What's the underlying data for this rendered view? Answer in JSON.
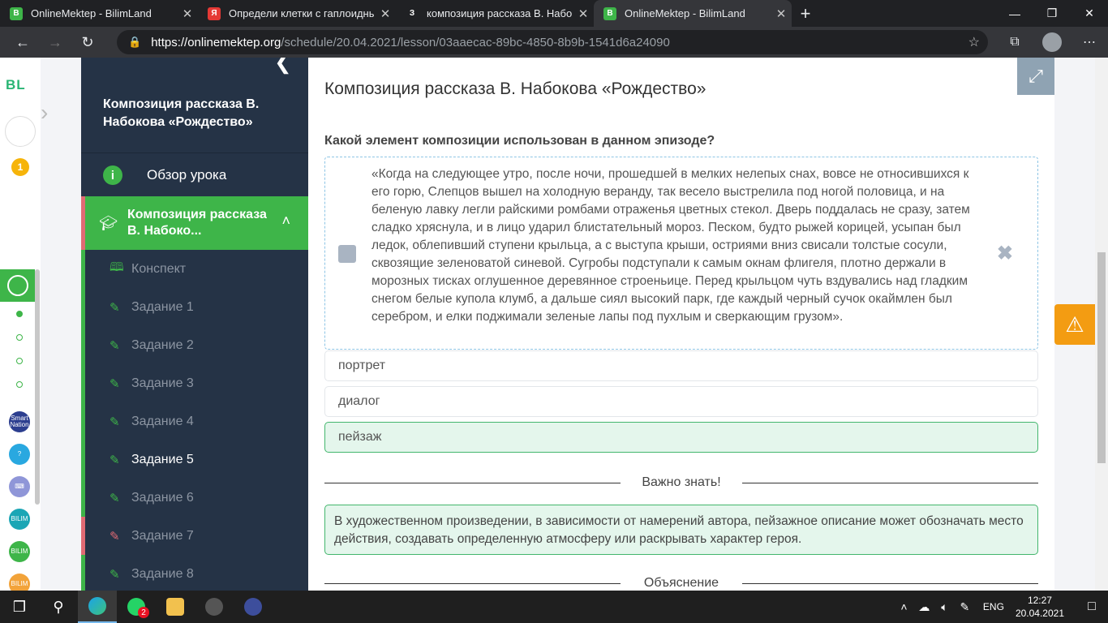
{
  "browser": {
    "tabs": [
      {
        "title": "OnlineMektep - BilimLand",
        "favicon_color": "#3eb549",
        "favicon_glyph": "B",
        "active": false
      },
      {
        "title": "Определи клетки с гаплоидным",
        "favicon_color": "#e53935",
        "favicon_glyph": "Я",
        "active": false
      },
      {
        "title": "композиция рассказа В. Набокова",
        "favicon_color": "#202124",
        "favicon_glyph": "З",
        "active": false
      },
      {
        "title": "OnlineMektep - BilimLand",
        "favicon_color": "#3eb549",
        "favicon_glyph": "B",
        "active": true
      }
    ],
    "url_host": "https://onlinemektep.org",
    "url_path": "/schedule/20.04.2021/lesson/03aaecac-89bc-4850-8b9b-1541d6a24090"
  },
  "rail": {
    "logo": "BL",
    "badge_count": "1",
    "apps": [
      {
        "name": "Smart Nation",
        "label": "Smart\nNation",
        "color": "#2c3e8f"
      },
      {
        "name": "help",
        "label": "?",
        "color": "#29a8e0"
      },
      {
        "name": "keyboard",
        "label": "⌨",
        "color": "#8f96d8"
      },
      {
        "name": "Bilim Online",
        "label": "BILIM",
        "color": "#1ba6b5"
      },
      {
        "name": "Bilim Land",
        "label": "BILIM",
        "color": "#3eb549"
      },
      {
        "name": "Bilim Shop",
        "label": "BILIM",
        "color": "#f2a33a"
      }
    ]
  },
  "sidebar": {
    "lesson_title": "Композиция рассказа В. Набокова «Рождество»",
    "overview_label": "Обзор урока",
    "active_section": "Композиция рассказа В. Набоко...",
    "items": [
      {
        "label": "Конспект",
        "icon": "book-icon",
        "state": "done"
      },
      {
        "label": "Задание 1",
        "icon": "edit-icon",
        "state": "done"
      },
      {
        "label": "Задание 2",
        "icon": "edit-icon",
        "state": "done"
      },
      {
        "label": "Задание 3",
        "icon": "edit-icon",
        "state": "done"
      },
      {
        "label": "Задание 4",
        "icon": "edit-icon",
        "state": "done"
      },
      {
        "label": "Задание 5",
        "icon": "edit-icon",
        "state": "current"
      },
      {
        "label": "Задание 6",
        "icon": "edit-icon",
        "state": "done"
      },
      {
        "label": "Задание 7",
        "icon": "edit-icon",
        "state": "wrong"
      },
      {
        "label": "Задание 8",
        "icon": "edit-icon",
        "state": "done"
      }
    ]
  },
  "content": {
    "title": "Композиция рассказа В. Набокова «Рождество»",
    "question": "Какой элемент композиции использован в данном эпизоде?",
    "quote": "«Когда на следующее утро, после ночи, прошедшей в мелких нелепых снах, вовсе не относившихся к его горю, Слепцов вышел на холодную веранду, так весело выстрелила под ногой половица, и на беленую лавку легли райскими ромбами отраженья цветных стекол. Дверь поддалась не сразу, затем сладко хряснула, и в лицо ударил блистательный мороз. Песком, будто рыжей корицей, усыпан был ледок, облепивший ступени крыльца, а с выступа крыши, остриями вниз свисали толстые сосули, сквозящие зеленоватой синевой. Сугробы подступали к самым окнам флигеля, плотно держали в морозных тисках оглушенное деревянное строеньице. Перед крыльцом чуть вздувались над гладким снегом белые купола клумб, а дальше сиял высокий парк, где каждый черный сучок окаймлен был серебром, и елки поджимали зеленые лапы под пухлым и сверкающим грузом».",
    "options": [
      {
        "label": "портрет",
        "correct": false
      },
      {
        "label": "диалог",
        "correct": false
      },
      {
        "label": "пейзаж",
        "correct": true
      }
    ],
    "important_heading": "Важно знать!",
    "important_text": "В художественном произведении, в зависимости от намерений автора, пейзажное описание может обозначать место действия, создавать определенную атмосферу или раскрывать характер героя.",
    "explanation_heading": "Объяснение"
  },
  "taskbar": {
    "lang": "ENG",
    "time": "12:27",
    "date": "20.04.2021",
    "whatsapp_badge": "2"
  },
  "colors": {
    "accent_green": "#3eb549",
    "sidebar_bg": "#253346",
    "error_red": "#e06a74",
    "warning_orange": "#f39c12"
  }
}
